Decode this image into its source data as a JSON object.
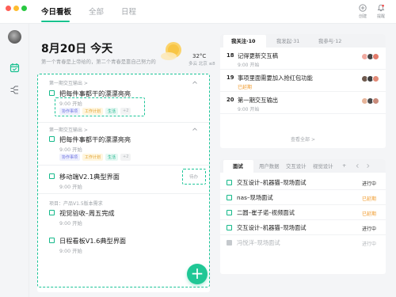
{
  "header": {
    "tabs": [
      {
        "label": "今日看板"
      },
      {
        "label": "全部"
      },
      {
        "label": "日程"
      }
    ],
    "actions": [
      {
        "label": "创建",
        "icon": "plus-circle-icon"
      },
      {
        "label": "提醒",
        "icon": "bell-icon"
      }
    ]
  },
  "sidebar": {
    "items": [
      {
        "icon": "avatar"
      },
      {
        "icon": "calendar-icon"
      },
      {
        "icon": "flow-icon"
      }
    ]
  },
  "today": {
    "date_title": "8月20日 今天",
    "subtitle": "第一个青春是上帝给的，第二个青春是靠自己努力的",
    "temperature": "32°C",
    "weather_text": "多云 北京 ≤8"
  },
  "task_groups": [
    {
      "title": "第一期交互输出 >",
      "tasks": [
        {
          "title": "把每件事都干的漂漂亮亮",
          "time": "9:00 开始",
          "tags": [
            "协作事项",
            "工作计划",
            "生活",
            "+2"
          ]
        }
      ]
    },
    {
      "title": "第一期交互输出 >",
      "tasks": [
        {
          "title": "把每件事都干的漂漂亮亮",
          "time": "9:00 开始",
          "tags": [
            "协作事项",
            "工作计划",
            "生活",
            "+2"
          ]
        }
      ]
    },
    {
      "title": "",
      "tasks": [
        {
          "title": "移动端V2.1典型界面",
          "time": "9:00 开始",
          "tags": [],
          "side_label": "待办"
        }
      ]
    },
    {
      "title": "项目：产品V1.5版本需求",
      "tasks": [
        {
          "title": "视觉验收–周五完成",
          "time": "9:00 开始",
          "tags": []
        },
        {
          "title": "日程看板V1.6典型界面",
          "time": "9:00 开始",
          "tags": []
        }
      ]
    }
  ],
  "fab": {
    "label": "+"
  },
  "focus": {
    "tabs": [
      {
        "label": "我关注·10"
      },
      {
        "label": "我发起·31"
      },
      {
        "label": "我参与·12"
      }
    ],
    "items": [
      {
        "day": "18",
        "title": "记得更新交互稿",
        "sub": "9:00 开始",
        "sub_status": "normal",
        "avatars": [
          "#f0a9a0",
          "#454545",
          "#e37b6b"
        ]
      },
      {
        "day": "19",
        "title": "事项里面需要加入抢红包功能",
        "sub": "已延期",
        "sub_status": "overdue",
        "avatars": [
          "#6f5a4e",
          "#3f3f3f",
          "#e28a77"
        ]
      },
      {
        "day": "20",
        "title": "第一期交互输出",
        "sub": "9:00 开始",
        "sub_status": "normal",
        "avatars": [
          "#e6b49a",
          "#4b4b4b",
          "#c98b7b"
        ]
      }
    ],
    "view_all": "查看全部 >"
  },
  "interviews": {
    "tabs": [
      {
        "label": "面试"
      },
      {
        "label": "用户数据"
      },
      {
        "label": "交互设计"
      },
      {
        "label": "视觉设计"
      },
      {
        "label": "+"
      }
    ],
    "items": [
      {
        "title": "交互设计–机器猫–现场面试",
        "status": "进行中",
        "status_type": "active",
        "checked": false
      },
      {
        "title": "nas–现场面试",
        "status": "已延期",
        "status_type": "overdue",
        "checked": false
      },
      {
        "title": "二圆–崔子诺–视频面试",
        "status": "已延期",
        "status_type": "overdue",
        "checked": false
      },
      {
        "title": "交互设计–机器猫–现场面试",
        "status": "进行中",
        "status_type": "active",
        "checked": false
      },
      {
        "title": "冯悦洋–现场面试",
        "status": "进行中",
        "status_type": "done",
        "checked": true
      }
    ]
  },
  "colors": {
    "accent": "#1fc795",
    "overdue": "#f09a2b",
    "tag_purple": "#6a6fe0",
    "tag_yellow": "#e0a02a",
    "tag_green": "#19b58b"
  }
}
